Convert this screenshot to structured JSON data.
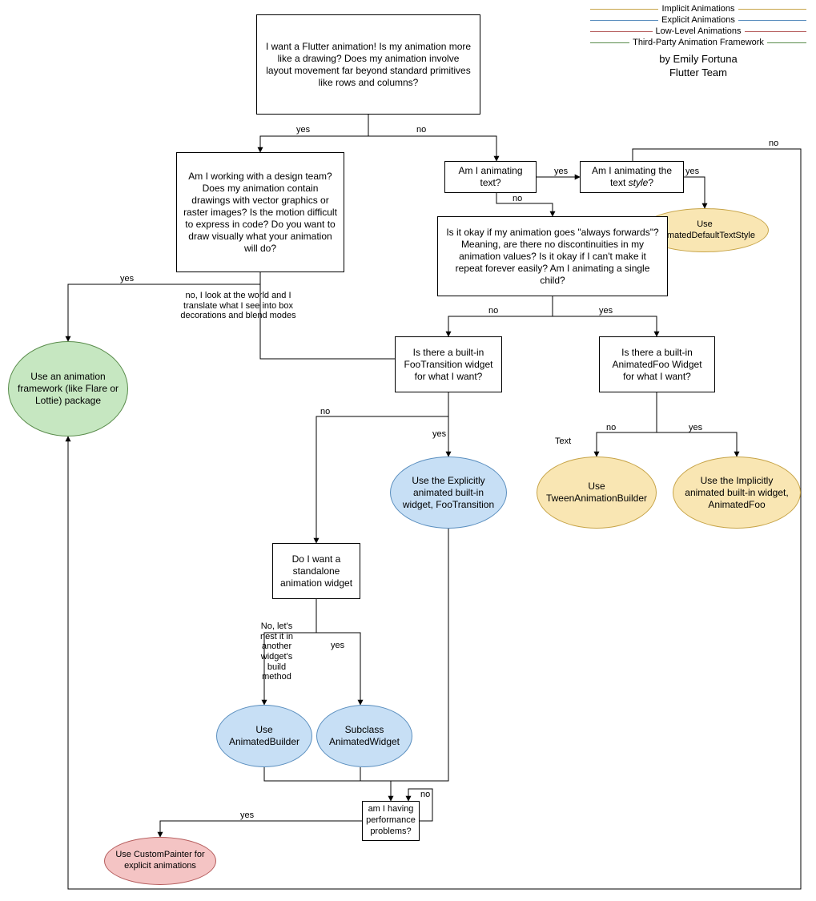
{
  "legend": {
    "implicit": "Implicit Animations",
    "explicit": "Explicit Animations",
    "lowlevel": "Low-Level Animations",
    "thirdparty": "Third-Party Animation Framework"
  },
  "byline": {
    "line1": "by Emily Fortuna",
    "line2": "Flutter Team"
  },
  "nodes": {
    "root": "I want a Flutter animation!\n\nIs my animation more like a drawing? Does my animation involve layout movement far beyond standard primitives like rows and columns?",
    "design_team": "Am I working with a design team? Does my animation contain drawings with vector graphics or raster images? Is the motion difficult to express in code? Do you want to draw visually what your animation will do?",
    "anim_text": "Am I animating text?",
    "anim_style_pre": "Am I animating the text ",
    "anim_style_em": "style",
    "anim_style_post": "?",
    "framework": "Use an animation framework (like Flare or Lottie) package",
    "adts": "Use AnimatedDefaultTextStyle",
    "forwards": "Is it okay if my animation goes \"always forwards\"? Meaning, are there no discontinuities in my animation values? Is it okay if I can't make it repeat forever easily? Am I animating a single child?",
    "foo_trans_q": "Is there a built-in FooTransition widget for what I want?",
    "anim_foo_q": "Is there a built-in AnimatedFoo Widget for what I want?",
    "foo_trans": "Use the Explicitly animated built-in widget, FooTransition",
    "tween": "Use TweenAnimationBuilder",
    "anim_foo": "Use the Implicitly animated built-in widget, AnimatedFoo",
    "standalone": "Do I want a standalone animation widget",
    "anim_builder": "Use AnimatedBuilder",
    "anim_widget": "Subclass AnimatedWidget",
    "perf": "am I having performance problems?",
    "custom_painter": "Use CustomPainter for explicit animations"
  },
  "edges": {
    "yes": "yes",
    "no": "no",
    "text_label": "Text",
    "no_box": "no, I look at the world and I translate what I see into box decorations and blend modes",
    "no_nest": "No, let's nest it in another widget's build method"
  },
  "colors": {
    "implicit": "#c7a448",
    "explicit": "#5b8fbf",
    "lowlevel": "#b55c5c",
    "thirdparty": "#5a8c4c"
  }
}
